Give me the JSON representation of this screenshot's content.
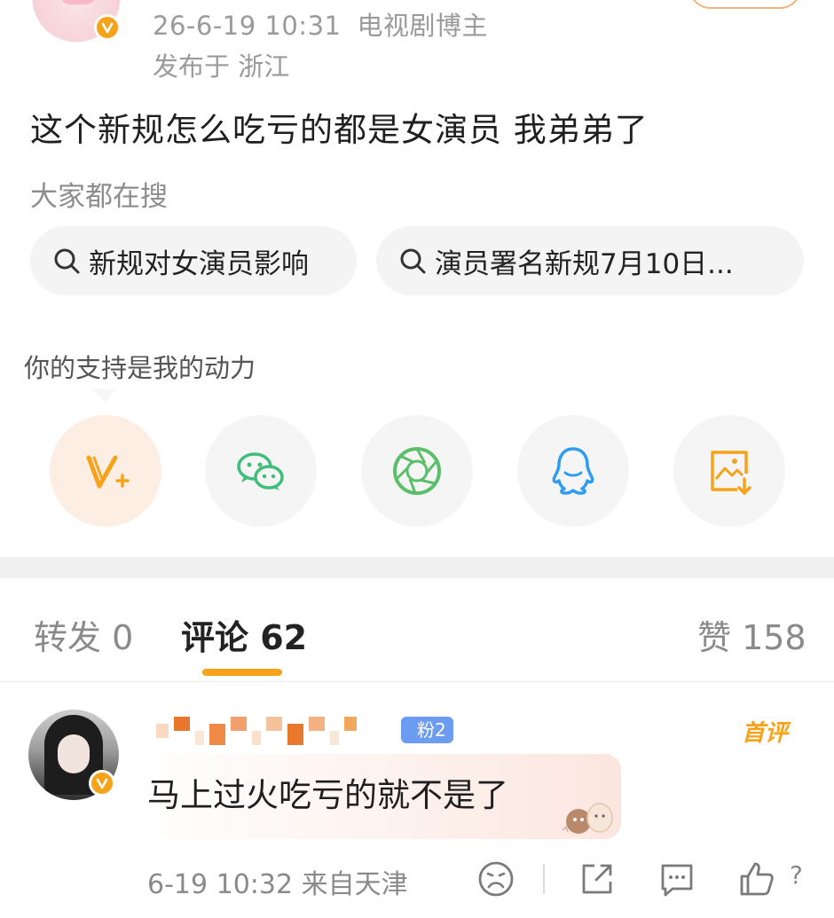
{
  "post": {
    "meta_time": "26-6-19 10:31",
    "meta_role": "电视剧博主",
    "location": "发布于 浙江",
    "text": "这个新规怎么吃亏的都是女演员 我弟弟了"
  },
  "search": {
    "title": "大家都在搜",
    "chips": [
      "新规对女演员影响",
      "演员署名新规7月10日..."
    ]
  },
  "support": {
    "prompt": "你的支持是我的动力",
    "share_icons": [
      "v-plus-icon",
      "wechat-icon",
      "moments-icon",
      "qq-icon",
      "save-image-icon"
    ]
  },
  "tabs": {
    "repost": "转发 0",
    "comments": "评论 62",
    "likes": "赞 158"
  },
  "comment": {
    "fan_badge": "粉2",
    "first_tag": "首评",
    "text": "马上过火吃亏的就不是了",
    "time_location": "6-19 10:32 来自天津",
    "like_count": "?"
  },
  "colors": {
    "accent": "#f7a21b",
    "wechat": "#3fbe7b",
    "moments": "#5bbf6a",
    "qq": "#2e9df0",
    "fan_badge": "#6b9cf2"
  }
}
